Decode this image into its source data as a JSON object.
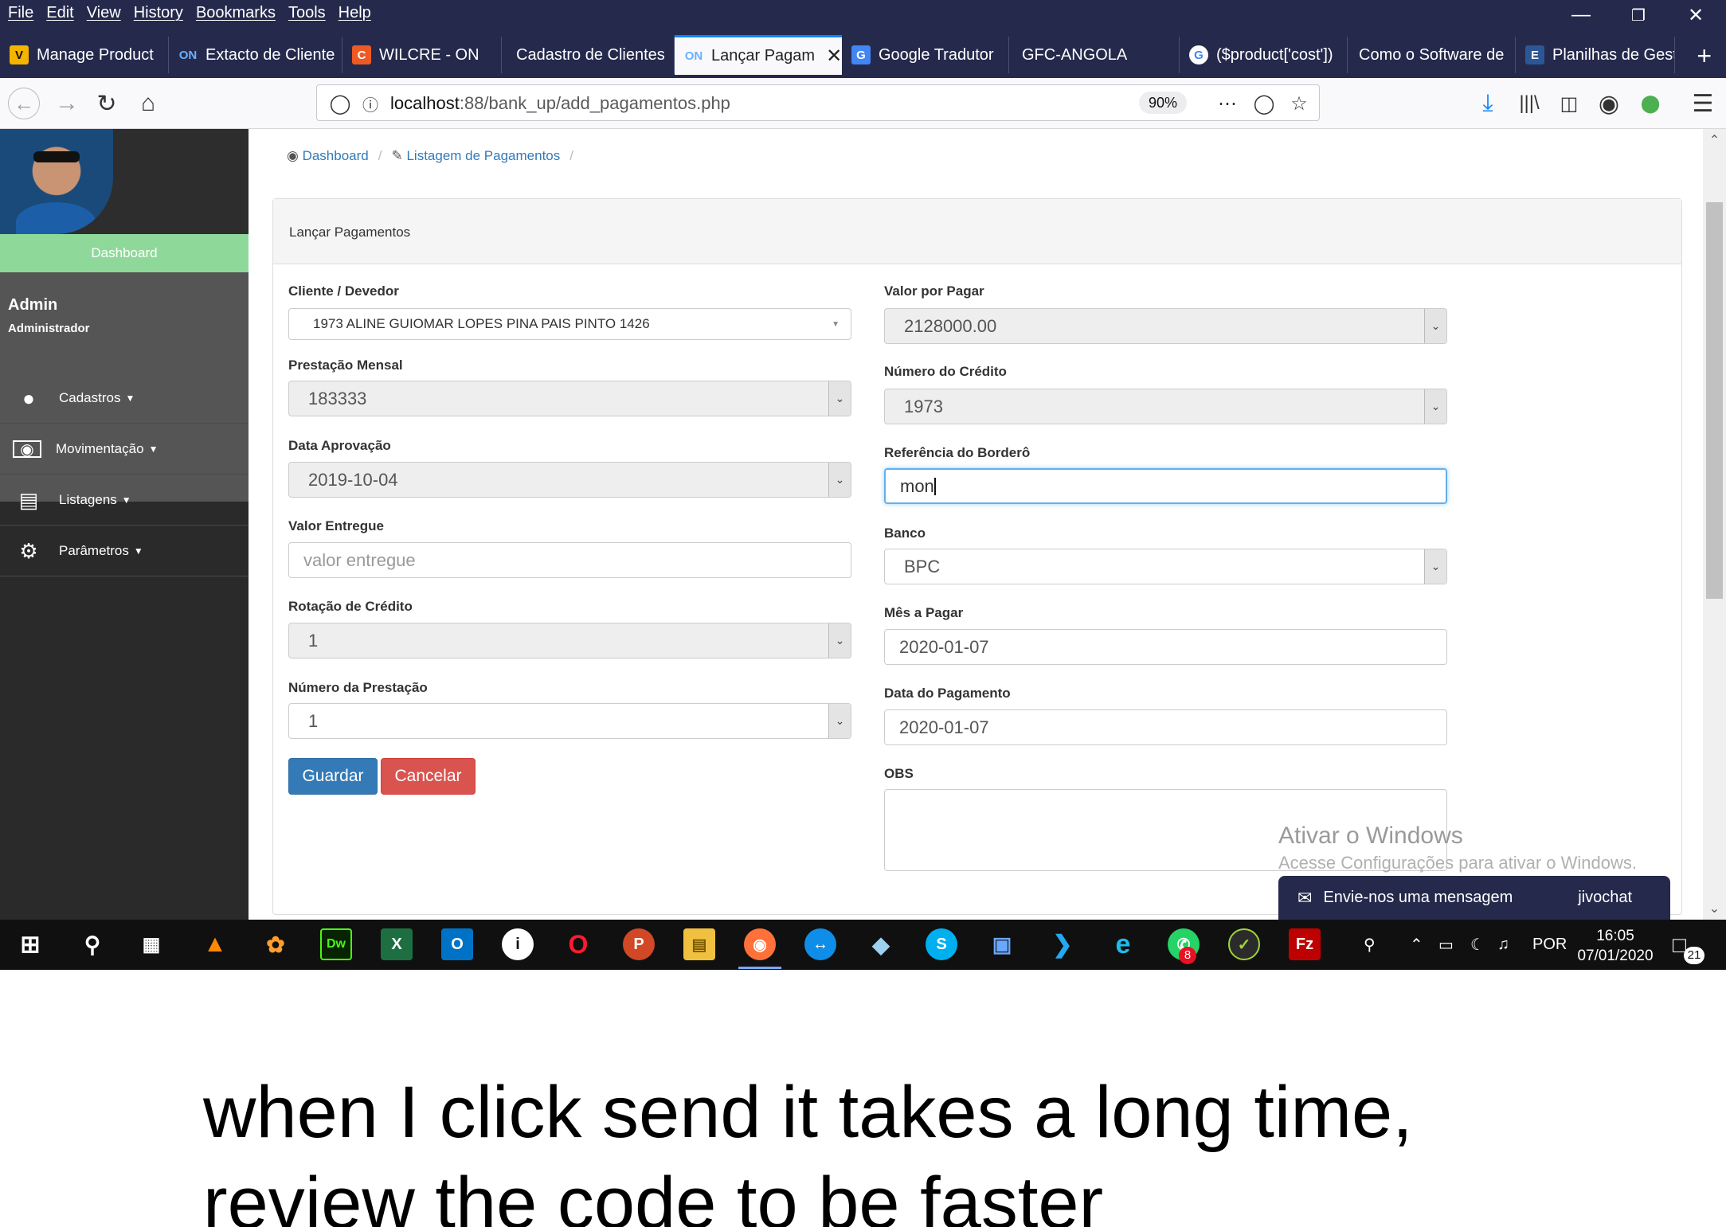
{
  "browser": {
    "menu": [
      "File",
      "Edit",
      "View",
      "History",
      "Bookmarks",
      "Tools",
      "Help"
    ],
    "tabs": [
      {
        "label": "Manage Product",
        "icon": "avada-icon",
        "color": "#f4b400",
        "active": false
      },
      {
        "label": "Extacto de Cliente",
        "icon": "on-logo-icon",
        "color": "#6ab0ff",
        "active": false
      },
      {
        "label": "WILCRE - ON",
        "icon": "codeigniter-icon",
        "color": "#ee5a24",
        "active": false
      },
      {
        "label": "Cadastro de Clientes",
        "icon": "",
        "color": "",
        "active": false
      },
      {
        "label": "Lançar Pagam",
        "icon": "on-logo-icon",
        "color": "#6ab0ff",
        "active": true
      },
      {
        "label": "Google Tradutor",
        "icon": "google-translate-icon",
        "color": "#4285f4",
        "active": false
      },
      {
        "label": "GFC-ANGOLA",
        "icon": "",
        "color": "",
        "active": false
      },
      {
        "label": "($product['cost'])",
        "icon": "google-icon",
        "color": "#ffffff",
        "active": false
      },
      {
        "label": "Como o Software de",
        "icon": "",
        "color": "",
        "active": false
      },
      {
        "label": "Planilhas de Gest",
        "icon": "spreadsheet-icon",
        "color": "#2b5797",
        "active": false
      }
    ],
    "url_host": "localhost",
    "url_path": ":88/bank_up/add_pagamentos.php",
    "zoom": "90%"
  },
  "sidebar": {
    "dashboard": "Dashboard",
    "user_name": "Admin",
    "user_role": "Administrador",
    "items": [
      {
        "label": "Cadastros",
        "icon": "user-icon"
      },
      {
        "label": "Movimentação",
        "icon": "money-icon"
      },
      {
        "label": "Listagens",
        "icon": "list-icon"
      },
      {
        "label": "Parâmetros",
        "icon": "gears-icon"
      }
    ]
  },
  "breadcrumb": {
    "dashboard": "Dashboard",
    "listagem": "Listagem de Pagamentos"
  },
  "panel": {
    "title": "Lançar Pagamentos"
  },
  "form": {
    "cliente_label": "Cliente / Devedor",
    "cliente_value": "1973 ALINE GUIOMAR LOPES PINA PAIS PINTO 1426",
    "prestacao_label": "Prestação Mensal",
    "prestacao_value": "183333",
    "data_aprov_label": "Data Aprovação",
    "data_aprov_value": "2019-10-04",
    "valor_entregue_label": "Valor Entregue",
    "valor_entregue_placeholder": "valor entregue",
    "rotacao_label": "Rotação de Crédito",
    "rotacao_value": "1",
    "num_prest_label": "Número da Prestação",
    "num_prest_value": "1",
    "valor_pagar_label": "Valor por Pagar",
    "valor_pagar_value": "2128000.00",
    "num_credito_label": "Número do Crédito",
    "num_credito_value": "1973",
    "ref_bordero_label": "Referência do Borderô",
    "ref_bordero_value": "mon",
    "banco_label": "Banco",
    "banco_value": "BPC",
    "mes_pagar_label": "Mês a Pagar",
    "mes_pagar_value": "2020-01-07",
    "data_pag_label": "Data do Pagamento",
    "data_pag_value": "2020-01-07",
    "obs_label": "OBS",
    "obs_value": "",
    "save_label": "Guardar",
    "cancel_label": "Cancelar"
  },
  "overlay": {
    "watermark_title": "Ativar o Windows",
    "watermark_sub": "Acesse Configurações para ativar o Windows.",
    "chat_label": "Envie-nos uma mensagem",
    "chat_brand": "jivochat"
  },
  "taskbar": {
    "language": "POR",
    "time": "16:05",
    "date": "07/01/2020",
    "notifications": "21",
    "whatsapp_badge": "8"
  },
  "caption": {
    "line1": "when I click send it takes a long time,",
    "line2": "review the code to be faster"
  },
  "colors": {
    "browser_chrome": "#252a4c",
    "sidebar_dashboard": "#8ed99a",
    "primary": "#337ab7",
    "danger": "#d9534f",
    "focus": "#66afe9"
  }
}
